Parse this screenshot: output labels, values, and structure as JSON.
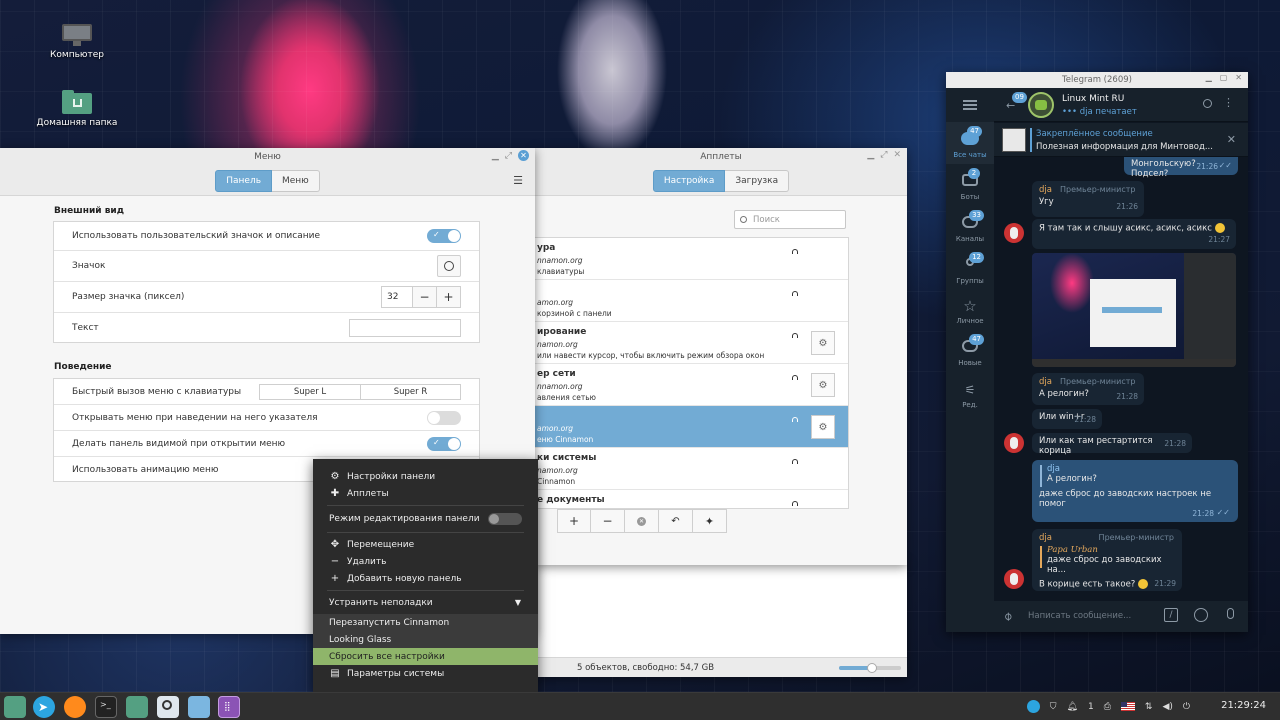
{
  "desktop": {
    "icons": [
      {
        "label": "Компьютер",
        "icon": "computer-icon"
      },
      {
        "label": "Домашняя папка",
        "icon": "home-folder-icon"
      }
    ]
  },
  "menu_window": {
    "title": "Меню",
    "tabs": [
      "Панель",
      "Меню"
    ],
    "active_tab": "Панель",
    "appearance": {
      "heading": "Внешний вид",
      "use_custom_icon_label": "Использовать пользовательский значок и описание",
      "use_custom_icon_on": true,
      "icon_label": "Значок",
      "icon_size_label": "Размер значка (пиксел)",
      "icon_size_value": "32",
      "text_label": "Текст",
      "text_value": ""
    },
    "behavior": {
      "heading": "Поведение",
      "hotkey_label": "Быстрый вызов меню с клавиатуры",
      "hotkey_1": "Super L",
      "hotkey_2": "Super R",
      "open_on_hover_label": "Открывать меню при наведении на него указателя",
      "open_on_hover_on": false,
      "panel_visible_label": "Делать панель видимой при открытии меню",
      "panel_visible_on": true,
      "animation_label": "Использовать анимацию меню"
    }
  },
  "applets_window": {
    "title": "Апплеты",
    "tabs": [
      "Настройка",
      "Загрузка"
    ],
    "active_tab": "Настройка",
    "search_placeholder": "Поиск",
    "items": [
      {
        "title": "ура",
        "author": "nnamon.org",
        "desc": "клавиатуры",
        "lock": true,
        "config": false,
        "selected": false
      },
      {
        "title": "",
        "author": "amon.org",
        "desc": "корзиной с панели",
        "lock": true,
        "config": false,
        "selected": false
      },
      {
        "title": "ирование",
        "author": "namon.org",
        "desc": "или навести курсор, чтобы включить режим обзора окон",
        "lock": true,
        "config": true,
        "selected": false
      },
      {
        "title": "ер сети",
        "author": "nnamon.org",
        "desc": "авления сетью",
        "lock": true,
        "config": true,
        "selected": false
      },
      {
        "title": "",
        "author": "amon.org",
        "desc": "еню Cinnamon",
        "lock": true,
        "config": true,
        "selected": true
      },
      {
        "title": "ки системы",
        "author": "namon.org",
        "desc": "Cinnamon",
        "lock": true,
        "config": false,
        "selected": false
      },
      {
        "title": "е документы",
        "author": "",
        "desc": "",
        "lock": true,
        "config": false,
        "selected": false
      }
    ],
    "toolbar": [
      "plus-icon",
      "minus-icon",
      "clear-icon",
      "undo-icon",
      "extensions-icon"
    ]
  },
  "file_manager": {
    "status": "5 объектов, свободно: 54,7 GB"
  },
  "context_menu": {
    "panel_settings": "Настройки панели",
    "applets": "Апплеты",
    "edit_mode": "Режим редактирования панели",
    "edit_mode_on": false,
    "move": "Перемещение",
    "remove": "Удалить",
    "add_panel": "Добавить новую панель",
    "troubleshoot": "Устранить неполадки",
    "restart": "Перезапустить Cinnamon",
    "looking_glass": "Looking Glass",
    "reset_all": "Сбросить все настройки",
    "system_settings": "Параметры системы"
  },
  "telegram": {
    "window_title": "Telegram (2609)",
    "back_badge": "09",
    "chat_name": "Linux Mint RU",
    "chat_status": "dja печатает",
    "pinned_title": "Закреплённое сообщение",
    "pinned_text": "Полезная информация для Минтовод...",
    "sidebar": [
      {
        "label": "Все чаты",
        "badge": "47",
        "icon": "chats-icon",
        "active": true
      },
      {
        "label": "Боты",
        "badge": "2",
        "icon": "bots-icon",
        "active": false
      },
      {
        "label": "Каналы",
        "badge": "33",
        "icon": "channels-icon",
        "active": false
      },
      {
        "label": "Группы",
        "badge": "12",
        "icon": "groups-icon",
        "active": false
      },
      {
        "label": "Личное",
        "badge": "",
        "icon": "star-icon",
        "active": false
      },
      {
        "label": "Новые",
        "badge": "47",
        "icon": "new-icon",
        "active": false
      },
      {
        "label": "Ред.",
        "badge": "",
        "icon": "edit-filters-icon",
        "active": false
      }
    ],
    "messages": {
      "m1_text": "Монгольскую? Подсел?",
      "m1_time": "21:26",
      "m2_name": "dja",
      "m2_role": "Премьер-министр",
      "m2_text": "Угу",
      "m2_time": "21:26",
      "m3_text": "Я там так и слышу асикс, асикс, асикс",
      "m3_time": "21:27",
      "m4_name": "dja",
      "m4_role": "Премьер-министр",
      "m4_text": "А релогин?",
      "m4_time": "21:28",
      "m5_text": "Или win+r",
      "m5_time": "21:28",
      "m6_text": "Или как там рестартится корица",
      "m6_time": "21:28",
      "m7_quote_name": "dja",
      "m7_quote_text": "А релогин?",
      "m7_text": "даже сброс до заводских настроек не помог",
      "m7_time": "21:28",
      "m8_name": "dja",
      "m8_role": "Премьер-министр",
      "m8_quote_name": "Papa Urban",
      "m8_quote_text": "даже сброс до заводских на...",
      "m8_text": "В корице есть такое?",
      "m8_time": "21:29"
    },
    "input_placeholder": "Написать сообщение..."
  },
  "taskbar": {
    "clock": "21:29:24",
    "tray_count": "1"
  },
  "colors": {
    "accent": "#72abd4",
    "highlight_green": "#8fb56a",
    "telegram_bg": "#0e1621",
    "telegram_panel": "#17212b",
    "telegram_out": "#2b5278",
    "telegram_in": "#182533"
  }
}
